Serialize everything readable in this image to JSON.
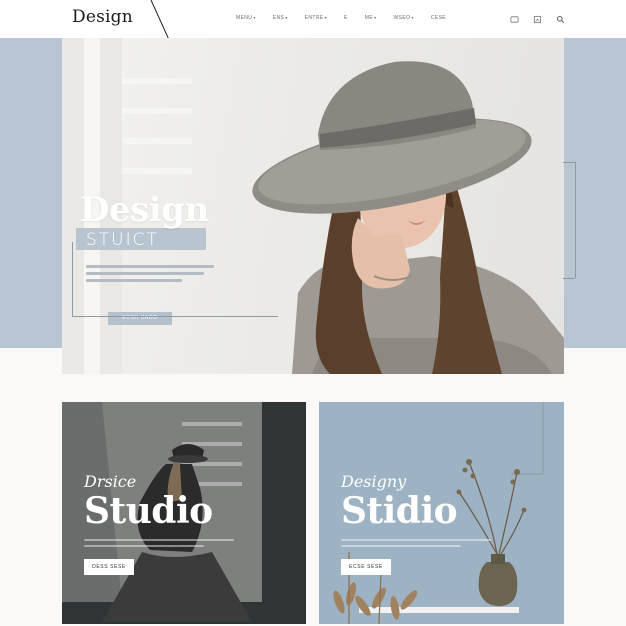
{
  "header": {
    "logo": "Design",
    "nav": [
      {
        "label": "MENU",
        "caret": "▾"
      },
      {
        "label": "ENS",
        "caret": "▾"
      },
      {
        "label": "ENTRE",
        "caret": "▾"
      },
      {
        "label": "E",
        "caret": ""
      },
      {
        "label": "ME",
        "caret": "▾"
      },
      {
        "label": "WSEO",
        "caret": "▾"
      },
      {
        "label": "CESE",
        "caret": ""
      }
    ],
    "icons": [
      "cart-icon",
      "image-icon",
      "search-icon"
    ]
  },
  "hero": {
    "title": "Design",
    "subtitle": "STUICT",
    "button_label": "ECSH CADO"
  },
  "cards": [
    {
      "script": "Drsice",
      "title": "Studio",
      "button_label": "DESS SESE"
    },
    {
      "script": "Designy",
      "title": "Stidio",
      "button_label": "ECSE SESE"
    }
  ],
  "colors": {
    "band": "#b7c6d2",
    "card_blue": "#9db2c2",
    "card_dark": "#2a2f30"
  }
}
